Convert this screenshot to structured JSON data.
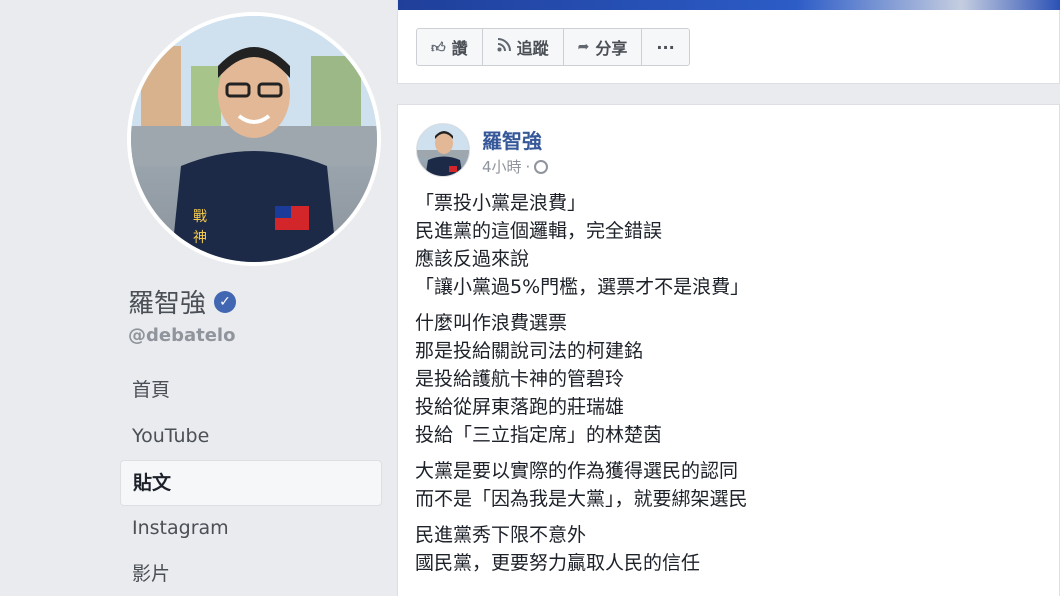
{
  "profile": {
    "name": "羅智強",
    "verified_icon": "verified-check-icon",
    "handle": "@debatelo"
  },
  "nav": {
    "items": [
      {
        "label": "首頁"
      },
      {
        "label": "YouTube"
      },
      {
        "label": "貼文"
      },
      {
        "label": "Instagram"
      },
      {
        "label": "影片"
      }
    ],
    "active_index": 2
  },
  "actions": {
    "like": {
      "label": "讚",
      "icon": "thumbs-up-icon"
    },
    "follow": {
      "label": "追蹤",
      "icon": "rss-follow-icon"
    },
    "share": {
      "label": "分享",
      "icon": "share-arrow-icon"
    },
    "more": {
      "label": "···",
      "icon": "more-dots-icon"
    }
  },
  "post": {
    "author": "羅智強",
    "time": "4小時",
    "separator": "·",
    "privacy_icon": "globe-icon",
    "paragraphs": [
      [
        "「票投小黨是浪費」",
        "民進黨的這個邏輯，完全錯誤",
        "應該反過來說",
        "「讓小黨過5%門檻，選票才不是浪費」"
      ],
      [
        "什麼叫作浪費選票",
        "那是投給關說司法的柯建銘",
        "是投給護航卡神的管碧玲",
        "投給從屏東落跑的莊瑞雄",
        "投給「三立指定席」的林楚茵"
      ],
      [
        "大黨是要以實際的作為獲得選民的認同",
        "而不是「因為我是大黨」，就要綁架選民"
      ],
      [
        "民進黨秀下限不意外",
        "國民黨，更要努力贏取人民的信任"
      ]
    ]
  },
  "colors": {
    "link": "#365899",
    "page_bg": "#e9ebee",
    "verified": "#4267b2"
  }
}
